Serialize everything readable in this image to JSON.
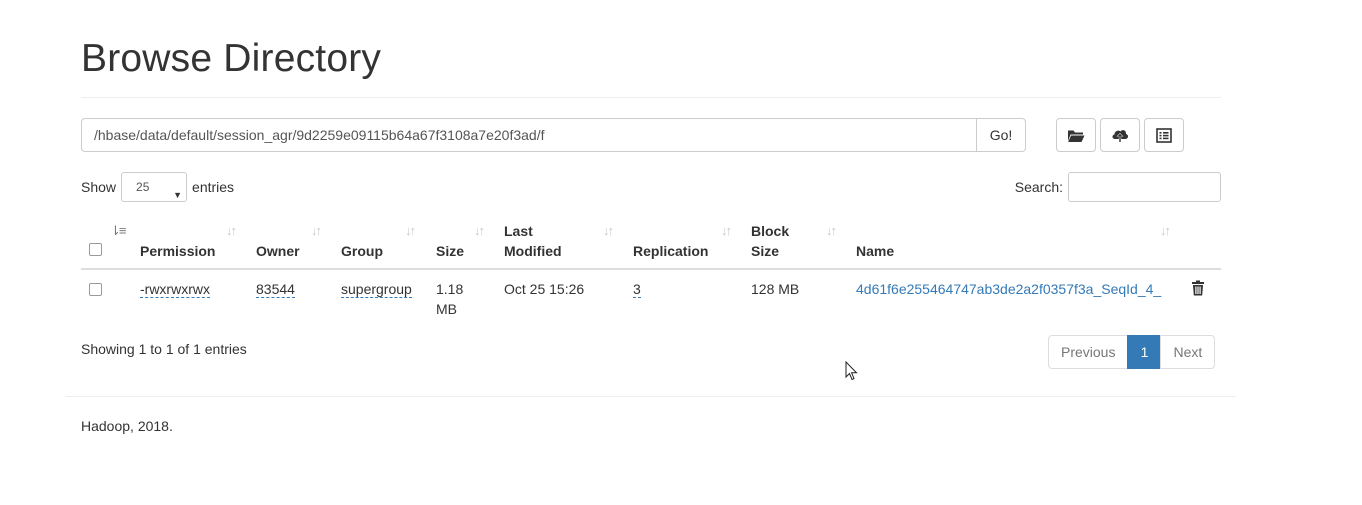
{
  "page": {
    "title": "Browse Directory",
    "footer": "Hadoop, 2018."
  },
  "path_bar": {
    "value": "/hbase/data/default/session_agr/9d2259e09115b64a67f3108a7e20f3ad/f",
    "go_label": "Go!"
  },
  "toolbar": {
    "icons": [
      "folder-open-icon",
      "cloud-upload-icon",
      "list-alt-icon"
    ]
  },
  "table_controls": {
    "show_label": "Show",
    "page_length": "25",
    "entries_label": "entries",
    "search_label": "Search:",
    "search_value": ""
  },
  "table": {
    "columns": [
      "Permission",
      "Owner",
      "Group",
      "Size",
      "Last",
      "Modified",
      "Replication",
      "Block",
      "Size",
      "Name"
    ],
    "headers": {
      "permission": "Permission",
      "owner": "Owner",
      "group": "Group",
      "size": "Size",
      "last_modified_1": "Last",
      "last_modified_2": "Modified",
      "replication": "Replication",
      "block_size_1": "Block",
      "block_size_2": "Size",
      "name": "Name"
    },
    "rows": [
      {
        "permission": "-rwxrwxrwx",
        "owner": "83544",
        "group": "supergroup",
        "size_1": "1.18",
        "size_2": "MB",
        "last_modified": "Oct 25 15:26",
        "replication": "3",
        "block_size": "128 MB",
        "name": "4d61f6e255464747ab3de2a2f0357f3a_SeqId_4_"
      }
    ]
  },
  "pagination": {
    "info": "Showing 1 to 1 of 1 entries",
    "previous": "Previous",
    "current": "1",
    "next": "Next"
  },
  "colors": {
    "link": "#337ab7",
    "border": "#cccccc"
  }
}
